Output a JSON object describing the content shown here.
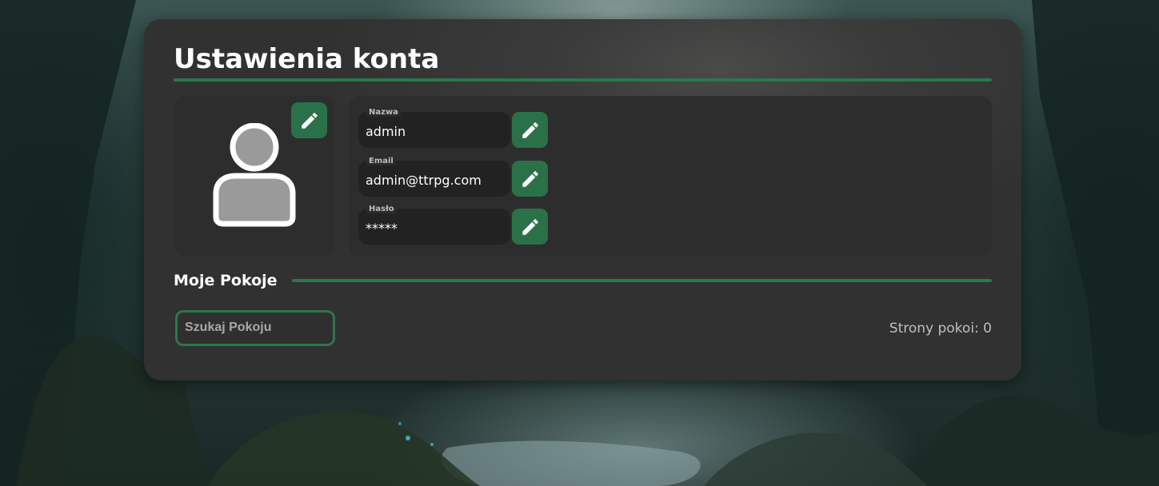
{
  "page_title": "Ustawienia konta",
  "avatar": {
    "icon": "user-silhouette-icon",
    "edit_icon": "pencil-icon"
  },
  "fields": [
    {
      "label": "Nazwa",
      "value": "admin",
      "edit_icon": "pencil-icon"
    },
    {
      "label": "Email",
      "value": "admin@ttrpg.com",
      "edit_icon": "pencil-icon"
    },
    {
      "label": "Hasło",
      "value": "*****",
      "edit_icon": "pencil-icon"
    }
  ],
  "rooms": {
    "title": "Moje Pokoje",
    "search_placeholder": "Szukaj Pokoju",
    "pages_label": "Strony pokoi: 0"
  },
  "colors": {
    "accent": "#2e7550",
    "button": "#2a7149",
    "panel": "#3a3b3a",
    "field": "#222222"
  }
}
